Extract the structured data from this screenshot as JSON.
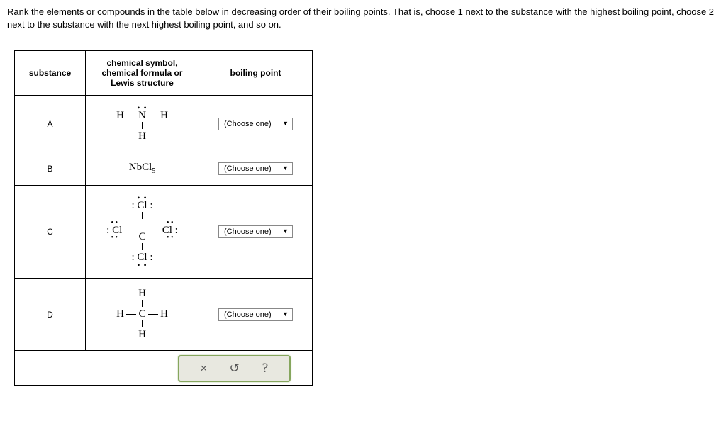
{
  "instructions": "Rank the elements or compounds in the table below in decreasing order of their boiling points. That is, choose 1 next to the substance with the highest boiling point, choose 2 next to the substance with the next highest boiling point, and so on.",
  "headers": {
    "substance": "substance",
    "formula": "chemical symbol, chemical formula or Lewis structure",
    "bp": "boiling point"
  },
  "rows": {
    "a": {
      "label": "A",
      "formula_desc": "NH3 (ammonia) Lewis structure: H—N—H with lone pair on N and one H below",
      "dd": "(Choose one)"
    },
    "b": {
      "label": "B",
      "formula_text": "NbCl",
      "formula_sub": "5",
      "dd": "(Choose one)"
    },
    "c": {
      "label": "C",
      "formula_desc": "CCl4 Lewis structure: central C bonded to four Cl each with three lone pairs",
      "dd": "(Choose one)"
    },
    "d": {
      "label": "D",
      "formula_desc": "CH4 (methane) Lewis structure: central C bonded to four H",
      "dd": "(Choose one)"
    }
  },
  "toolbar": {
    "close": "×",
    "reset": "↺",
    "help": "?"
  }
}
